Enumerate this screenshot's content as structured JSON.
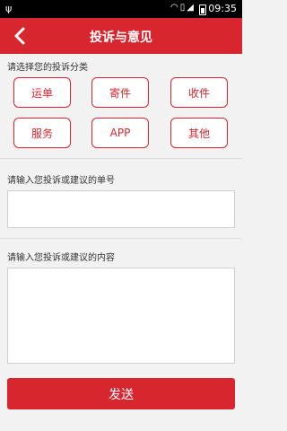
{
  "status_bar": {
    "time": "09:35",
    "icons": [
      "usb-icon",
      "wifi-icon",
      "sim-icon",
      "signal-icon",
      "battery-icon"
    ]
  },
  "header": {
    "title": "投诉与意见",
    "back_icon": "back-arrow-icon"
  },
  "category": {
    "label": "请选择您的投诉分类",
    "options": [
      "运单",
      "寄件",
      "收件",
      "服务",
      "APP",
      "其他"
    ]
  },
  "order_number": {
    "label": "请输入您投诉或建议的单号",
    "value": ""
  },
  "content": {
    "label": "请输入您投诉或建议的内容",
    "value": ""
  },
  "submit": {
    "label": "发送"
  },
  "colors": {
    "accent": "#d8262f",
    "background": "#f2f2f2"
  }
}
